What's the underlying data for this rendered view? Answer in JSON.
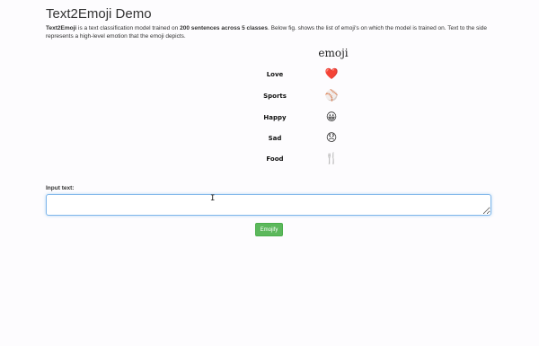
{
  "page": {
    "title": "Text2Emoji Demo",
    "description": {
      "lead": "Text2Emoji",
      "part1": " is a text classification model trained on ",
      "bold": "200 sentences across 5 classes",
      "part2": ". Below fig. shows the list of emoji's on which the model is trained on. Text to the side represents a high-level emotion that the emoji depicts."
    }
  },
  "emoji_table": {
    "header": "emoji",
    "rows": [
      {
        "label": "Love",
        "emoji": "❤️",
        "icon": "heart-icon",
        "color": "#e0112b"
      },
      {
        "label": "Sports",
        "emoji": "⚾",
        "icon": "baseball-icon",
        "color": "#c9c9c9"
      },
      {
        "label": "Happy",
        "emoji": "😀",
        "icon": "smiley-icon",
        "color": "#f4c21a"
      },
      {
        "label": "Sad",
        "emoji": "😞",
        "icon": "sad-face-icon",
        "color": "#f4c21a"
      },
      {
        "label": "Food",
        "emoji": "🍴",
        "icon": "fork-knife-icon",
        "color": "#9a9a9a"
      }
    ]
  },
  "form": {
    "input_label": "Input text:",
    "input_value": "",
    "button_label": "Emojify",
    "accent": "#5cb85c",
    "focus_border": "#7fb6ea"
  }
}
